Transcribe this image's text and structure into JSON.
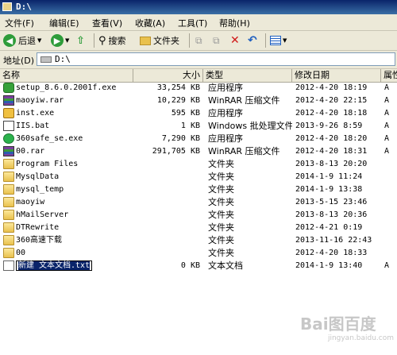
{
  "window": {
    "title": "D:\\"
  },
  "menu": [
    {
      "label": "文件(F)"
    },
    {
      "label": "编辑(E)"
    },
    {
      "label": "查看(V)"
    },
    {
      "label": "收藏(A)"
    },
    {
      "label": "工具(T)"
    },
    {
      "label": "帮助(H)"
    }
  ],
  "toolbar": {
    "back_label": "后退",
    "search_label": "搜索",
    "folders_label": "文件夹"
  },
  "address": {
    "label": "地址(D)",
    "value": "D:\\"
  },
  "columns": {
    "name": "名称",
    "size": "大小",
    "type": "类型",
    "modified": "修改日期",
    "attr": "属性"
  },
  "files": [
    {
      "icon": "setup-icon",
      "name": "setup_8.6.0.2001f.exe",
      "size": "33,254 KB",
      "type": "应用程序",
      "modified": "2012-4-20 18:19",
      "attr": "A"
    },
    {
      "icon": "rar-icon",
      "name": "maoyiw.rar",
      "size": "10,229 KB",
      "type": "WinRAR 压缩文件",
      "modified": "2012-4-20 22:15",
      "attr": "A"
    },
    {
      "icon": "installer-icon",
      "name": "inst.exe",
      "size": "595 KB",
      "type": "应用程序",
      "modified": "2012-4-20 18:18",
      "attr": "A"
    },
    {
      "icon": "batch-icon",
      "name": "IIS.bat",
      "size": "1 KB",
      "type": "Windows 批处理文件",
      "modified": "2013-9-26 8:59",
      "attr": "A"
    },
    {
      "icon": "safe360-icon",
      "name": "360safe_se.exe",
      "size": "7,290 KB",
      "type": "应用程序",
      "modified": "2012-4-20 18:20",
      "attr": "A"
    },
    {
      "icon": "rar-icon",
      "name": "00.rar",
      "size": "291,705 KB",
      "type": "WinRAR 压缩文件",
      "modified": "2012-4-20 18:31",
      "attr": "A"
    },
    {
      "icon": "folder-icon",
      "name": "Program Files",
      "size": "",
      "type": "文件夹",
      "modified": "2013-8-13 20:20",
      "attr": ""
    },
    {
      "icon": "folder-icon",
      "name": "MysqlData",
      "size": "",
      "type": "文件夹",
      "modified": "2014-1-9 11:24",
      "attr": ""
    },
    {
      "icon": "folder-icon",
      "name": "mysql_temp",
      "size": "",
      "type": "文件夹",
      "modified": "2014-1-9 13:38",
      "attr": ""
    },
    {
      "icon": "folder-icon",
      "name": "maoyiw",
      "size": "",
      "type": "文件夹",
      "modified": "2013-5-15 23:46",
      "attr": ""
    },
    {
      "icon": "folder-icon",
      "name": "hMailServer",
      "size": "",
      "type": "文件夹",
      "modified": "2013-8-13 20:36",
      "attr": ""
    },
    {
      "icon": "folder-icon",
      "name": "DTRewrite",
      "size": "",
      "type": "文件夹",
      "modified": "2012-4-21 0:19",
      "attr": ""
    },
    {
      "icon": "folder-icon",
      "name": "360高速下载",
      "size": "",
      "type": "文件夹",
      "modified": "2013-11-16 22:43",
      "attr": ""
    },
    {
      "icon": "folder-icon",
      "name": "00",
      "size": "",
      "type": "文件夹",
      "modified": "2012-4-20 18:33",
      "attr": ""
    },
    {
      "icon": "text-file-icon",
      "name": "新建 文本文档.txt",
      "size": "0 KB",
      "type": "文本文档",
      "modified": "2014-1-9 13:40",
      "attr": "A",
      "editing": true
    }
  ],
  "watermark": {
    "line1": "Bai图百度",
    "line2": "jingyan.baidu.com"
  }
}
